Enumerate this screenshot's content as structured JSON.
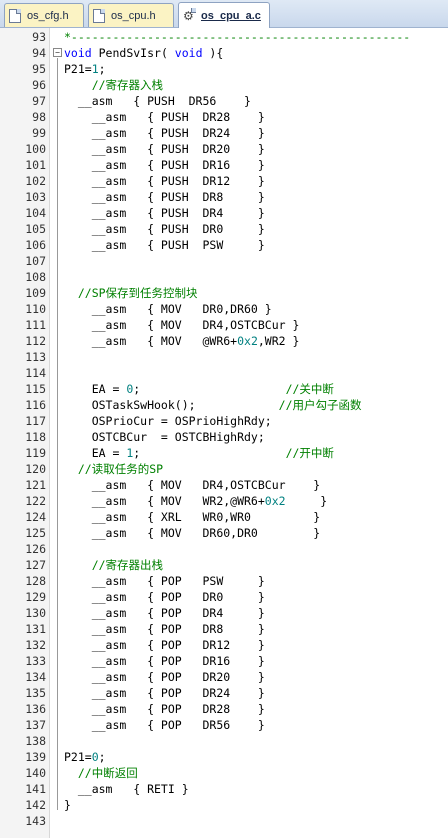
{
  "tabs": [
    {
      "label": "os_cfg.h",
      "active": false
    },
    {
      "label": "os_cpu.h",
      "active": false
    },
    {
      "label": "os_cpu_a.c",
      "active": true
    }
  ],
  "lines": [
    {
      "n": "93",
      "parts": [
        {
          "t": "*-------------------------------------------------",
          "c": "cm"
        }
      ]
    },
    {
      "n": "94",
      "fold": "−",
      "parts": [
        {
          "t": "void",
          "c": "kw"
        },
        {
          "t": " PendSvIsr( ",
          "c": ""
        },
        {
          "t": "void",
          "c": "kw"
        },
        {
          "t": " ){",
          "c": ""
        }
      ]
    },
    {
      "n": "95",
      "parts": [
        {
          "t": "P21=",
          "c": ""
        },
        {
          "t": "1",
          "c": "num"
        },
        {
          "t": ";",
          "c": ""
        }
      ]
    },
    {
      "n": "96",
      "parts": [
        {
          "t": "    //寄存器入栈",
          "c": "cm"
        }
      ]
    },
    {
      "n": "97",
      "parts": [
        {
          "t": "  __asm   { PUSH  DR56    }",
          "c": ""
        }
      ]
    },
    {
      "n": "98",
      "parts": [
        {
          "t": "    __asm   { PUSH  DR28    }",
          "c": ""
        }
      ]
    },
    {
      "n": "99",
      "parts": [
        {
          "t": "    __asm   { PUSH  DR24    }",
          "c": ""
        }
      ]
    },
    {
      "n": "100",
      "parts": [
        {
          "t": "    __asm   { PUSH  DR20    }",
          "c": ""
        }
      ]
    },
    {
      "n": "101",
      "parts": [
        {
          "t": "    __asm   { PUSH  DR16    }",
          "c": ""
        }
      ]
    },
    {
      "n": "102",
      "parts": [
        {
          "t": "    __asm   { PUSH  DR12    }",
          "c": ""
        }
      ]
    },
    {
      "n": "103",
      "parts": [
        {
          "t": "    __asm   { PUSH  DR8     }",
          "c": ""
        }
      ]
    },
    {
      "n": "104",
      "parts": [
        {
          "t": "    __asm   { PUSH  DR4     }",
          "c": ""
        }
      ]
    },
    {
      "n": "105",
      "parts": [
        {
          "t": "    __asm   { PUSH  DR0     }",
          "c": ""
        }
      ]
    },
    {
      "n": "106",
      "parts": [
        {
          "t": "    __asm   { PUSH  PSW     }",
          "c": ""
        }
      ]
    },
    {
      "n": "107",
      "parts": []
    },
    {
      "n": "108",
      "parts": []
    },
    {
      "n": "109",
      "parts": [
        {
          "t": "  //SP保存到任务控制块",
          "c": "cm"
        }
      ]
    },
    {
      "n": "110",
      "parts": [
        {
          "t": "    __asm   { MOV   DR0,DR60 }",
          "c": ""
        }
      ]
    },
    {
      "n": "111",
      "parts": [
        {
          "t": "    __asm   { MOV   DR4,OSTCBCur }",
          "c": ""
        }
      ]
    },
    {
      "n": "112",
      "parts": [
        {
          "t": "    __asm   { MOV   @WR6+",
          "c": ""
        },
        {
          "t": "0x2",
          "c": "num"
        },
        {
          "t": ",WR2 }",
          "c": ""
        }
      ]
    },
    {
      "n": "113",
      "parts": []
    },
    {
      "n": "114",
      "parts": []
    },
    {
      "n": "115",
      "parts": [
        {
          "t": "    EA = ",
          "c": ""
        },
        {
          "t": "0",
          "c": "num"
        },
        {
          "t": ";                     ",
          "c": ""
        },
        {
          "t": "//关中断",
          "c": "cm"
        }
      ]
    },
    {
      "n": "116",
      "parts": [
        {
          "t": "    OSTaskSwHook();            ",
          "c": ""
        },
        {
          "t": "//用户勾子函数",
          "c": "cm"
        }
      ]
    },
    {
      "n": "117",
      "parts": [
        {
          "t": "    OSPrioCur = OSPrioHighRdy;",
          "c": ""
        }
      ]
    },
    {
      "n": "118",
      "parts": [
        {
          "t": "    OSTCBCur  = OSTCBHighRdy;",
          "c": ""
        }
      ]
    },
    {
      "n": "119",
      "parts": [
        {
          "t": "    EA = ",
          "c": ""
        },
        {
          "t": "1",
          "c": "num"
        },
        {
          "t": ";                     ",
          "c": ""
        },
        {
          "t": "//开中断",
          "c": "cm"
        }
      ]
    },
    {
      "n": "120",
      "parts": [
        {
          "t": "  //读取任务的SP",
          "c": "cm"
        }
      ]
    },
    {
      "n": "121",
      "parts": [
        {
          "t": "    __asm   { MOV   DR4,OSTCBCur    }",
          "c": ""
        }
      ]
    },
    {
      "n": "122",
      "parts": [
        {
          "t": "    __asm   { MOV   WR2,@WR6+",
          "c": ""
        },
        {
          "t": "0x2",
          "c": "num"
        },
        {
          "t": "     }",
          "c": ""
        }
      ]
    },
    {
      "n": "124",
      "parts": [
        {
          "t": "    __asm   { XRL   WR0,WR0         }",
          "c": ""
        }
      ]
    },
    {
      "n": "125",
      "parts": [
        {
          "t": "    __asm   { MOV   DR60,DR0        }",
          "c": ""
        }
      ]
    },
    {
      "n": "126",
      "parts": []
    },
    {
      "n": "127",
      "parts": [
        {
          "t": "    //寄存器出栈",
          "c": "cm"
        }
      ]
    },
    {
      "n": "128",
      "parts": [
        {
          "t": "    __asm   { POP   PSW     }",
          "c": ""
        }
      ]
    },
    {
      "n": "129",
      "parts": [
        {
          "t": "    __asm   { POP   DR0     }",
          "c": ""
        }
      ]
    },
    {
      "n": "130",
      "parts": [
        {
          "t": "    __asm   { POP   DR4     }",
          "c": ""
        }
      ]
    },
    {
      "n": "131",
      "parts": [
        {
          "t": "    __asm   { POP   DR8     }",
          "c": ""
        }
      ]
    },
    {
      "n": "132",
      "parts": [
        {
          "t": "    __asm   { POP   DR12    }",
          "c": ""
        }
      ]
    },
    {
      "n": "133",
      "parts": [
        {
          "t": "    __asm   { POP   DR16    }",
          "c": ""
        }
      ]
    },
    {
      "n": "134",
      "parts": [
        {
          "t": "    __asm   { POP   DR20    }",
          "c": ""
        }
      ]
    },
    {
      "n": "135",
      "parts": [
        {
          "t": "    __asm   { POP   DR24    }",
          "c": ""
        }
      ]
    },
    {
      "n": "136",
      "parts": [
        {
          "t": "    __asm   { POP   DR28    }",
          "c": ""
        }
      ]
    },
    {
      "n": "137",
      "parts": [
        {
          "t": "    __asm   { POP   DR56    }",
          "c": ""
        }
      ]
    },
    {
      "n": "138",
      "parts": []
    },
    {
      "n": "139",
      "parts": [
        {
          "t": "P21=",
          "c": ""
        },
        {
          "t": "0",
          "c": "num"
        },
        {
          "t": ";",
          "c": ""
        }
      ]
    },
    {
      "n": "140",
      "parts": [
        {
          "t": "  //中断返回",
          "c": "cm"
        }
      ]
    },
    {
      "n": "141",
      "parts": [
        {
          "t": "  __asm   { RETI }",
          "c": ""
        }
      ]
    },
    {
      "n": "142",
      "parts": [
        {
          "t": "}",
          "c": ""
        }
      ]
    },
    {
      "n": "143",
      "parts": []
    }
  ]
}
